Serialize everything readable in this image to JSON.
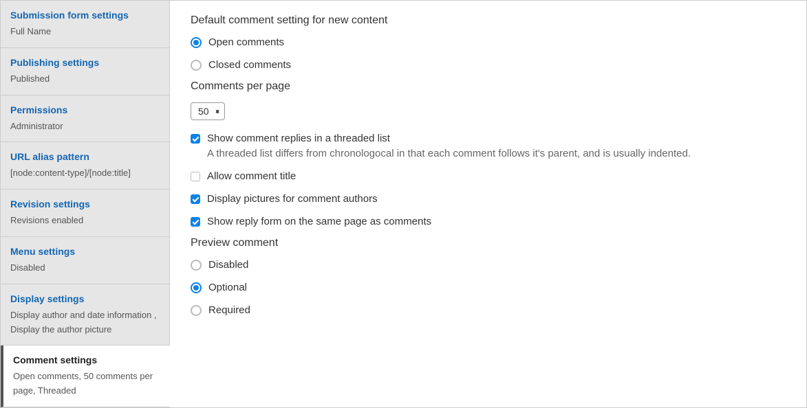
{
  "sidebar": {
    "items": [
      {
        "title": "Submission form settings",
        "summary": "Full Name"
      },
      {
        "title": "Publishing settings",
        "summary": "Published"
      },
      {
        "title": "Permissions",
        "summary": "Administrator"
      },
      {
        "title": "URL alias pattern",
        "summary": "[node:content-type]/[node:title]"
      },
      {
        "title": "Revision settings",
        "summary": "Revisions enabled"
      },
      {
        "title": "Menu settings",
        "summary": "Disabled"
      },
      {
        "title": "Display settings",
        "summary": "Display author and date information , Display the author picture"
      },
      {
        "title": "Comment settings",
        "summary": "Open comments, 50 comments per page, Threaded"
      }
    ]
  },
  "main": {
    "default_comment_heading": "Default comment setting for new content",
    "radio_open": "Open comments",
    "radio_closed": "Closed comments",
    "comments_per_page_heading": "Comments per page",
    "comments_per_page_value": "50",
    "threaded_label": "Show comment replies in a threaded list",
    "threaded_help": "A threaded list differs from chronologocal in that each comment follows it's parent, and is usually indented.",
    "allow_title_label": "Allow comment title",
    "display_pics_label": "Display pictures for comment authors",
    "show_reply_label": "Show reply form on the same page as comments",
    "preview_heading": "Preview comment",
    "preview_disabled": "Disabled",
    "preview_optional": "Optional",
    "preview_required": "Required"
  }
}
